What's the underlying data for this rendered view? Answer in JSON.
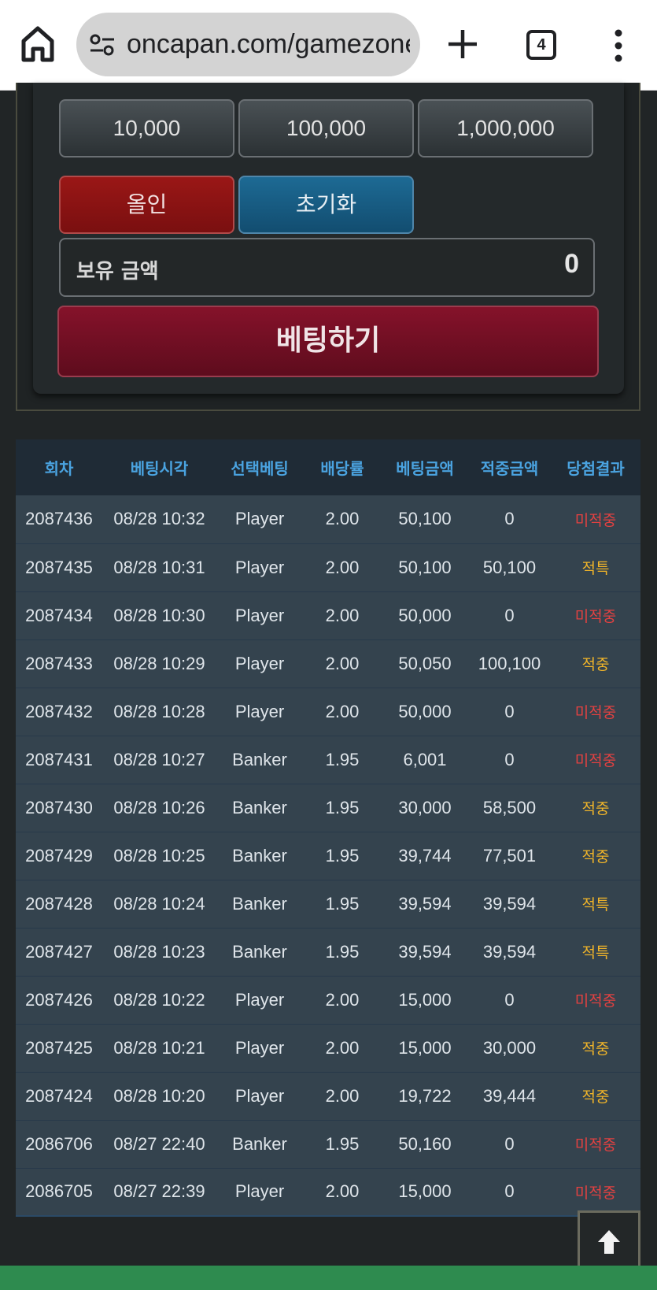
{
  "browser": {
    "url": "oncapan.com/gamezone",
    "tab_count": "4"
  },
  "bet_panel": {
    "chips": [
      "10,000",
      "100,000",
      "1,000,000"
    ],
    "allin_label": "올인",
    "reset_label": "초기화",
    "balance_label": "보유 금액",
    "balance_value": "0",
    "bet_label": "베팅하기"
  },
  "history": {
    "headers": [
      "회차",
      "베팅시각",
      "선택베팅",
      "배당률",
      "베팅금액",
      "적중금액",
      "당첨결과"
    ],
    "rows": [
      {
        "round": "2087436",
        "time": "08/28 10:32",
        "pick": "Player",
        "odds": "2.00",
        "bet": "50,100",
        "win": "0",
        "result": "미적중",
        "status": "miss"
      },
      {
        "round": "2087435",
        "time": "08/28 10:31",
        "pick": "Player",
        "odds": "2.00",
        "bet": "50,100",
        "win": "50,100",
        "result": "적특",
        "status": "hit"
      },
      {
        "round": "2087434",
        "time": "08/28 10:30",
        "pick": "Player",
        "odds": "2.00",
        "bet": "50,000",
        "win": "0",
        "result": "미적중",
        "status": "miss"
      },
      {
        "round": "2087433",
        "time": "08/28 10:29",
        "pick": "Player",
        "odds": "2.00",
        "bet": "50,050",
        "win": "100,100",
        "result": "적중",
        "status": "hit"
      },
      {
        "round": "2087432",
        "time": "08/28 10:28",
        "pick": "Player",
        "odds": "2.00",
        "bet": "50,000",
        "win": "0",
        "result": "미적중",
        "status": "miss"
      },
      {
        "round": "2087431",
        "time": "08/28 10:27",
        "pick": "Banker",
        "odds": "1.95",
        "bet": "6,001",
        "win": "0",
        "result": "미적중",
        "status": "miss"
      },
      {
        "round": "2087430",
        "time": "08/28 10:26",
        "pick": "Banker",
        "odds": "1.95",
        "bet": "30,000",
        "win": "58,500",
        "result": "적중",
        "status": "hit"
      },
      {
        "round": "2087429",
        "time": "08/28 10:25",
        "pick": "Banker",
        "odds": "1.95",
        "bet": "39,744",
        "win": "77,501",
        "result": "적중",
        "status": "hit"
      },
      {
        "round": "2087428",
        "time": "08/28 10:24",
        "pick": "Banker",
        "odds": "1.95",
        "bet": "39,594",
        "win": "39,594",
        "result": "적특",
        "status": "hit"
      },
      {
        "round": "2087427",
        "time": "08/28 10:23",
        "pick": "Banker",
        "odds": "1.95",
        "bet": "39,594",
        "win": "39,594",
        "result": "적특",
        "status": "hit"
      },
      {
        "round": "2087426",
        "time": "08/28 10:22",
        "pick": "Player",
        "odds": "2.00",
        "bet": "15,000",
        "win": "0",
        "result": "미적중",
        "status": "miss"
      },
      {
        "round": "2087425",
        "time": "08/28 10:21",
        "pick": "Player",
        "odds": "2.00",
        "bet": "15,000",
        "win": "30,000",
        "result": "적중",
        "status": "hit"
      },
      {
        "round": "2087424",
        "time": "08/28 10:20",
        "pick": "Player",
        "odds": "2.00",
        "bet": "19,722",
        "win": "39,444",
        "result": "적중",
        "status": "hit"
      },
      {
        "round": "2086706",
        "time": "08/27 22:40",
        "pick": "Banker",
        "odds": "1.95",
        "bet": "50,160",
        "win": "0",
        "result": "미적중",
        "status": "miss"
      },
      {
        "round": "2086705",
        "time": "08/27 22:39",
        "pick": "Player",
        "odds": "2.00",
        "bet": "15,000",
        "win": "0",
        "result": "미적중",
        "status": "miss"
      }
    ]
  },
  "colors": {
    "miss": "#e34141",
    "hit": "#f0b429",
    "header_text": "#4aa3e0"
  },
  "icons": {
    "home": "home-icon",
    "site_info": "tune-icon",
    "new_tab": "plus-icon",
    "menu": "more-vert-icon",
    "scroll_top": "arrow-up-icon"
  }
}
